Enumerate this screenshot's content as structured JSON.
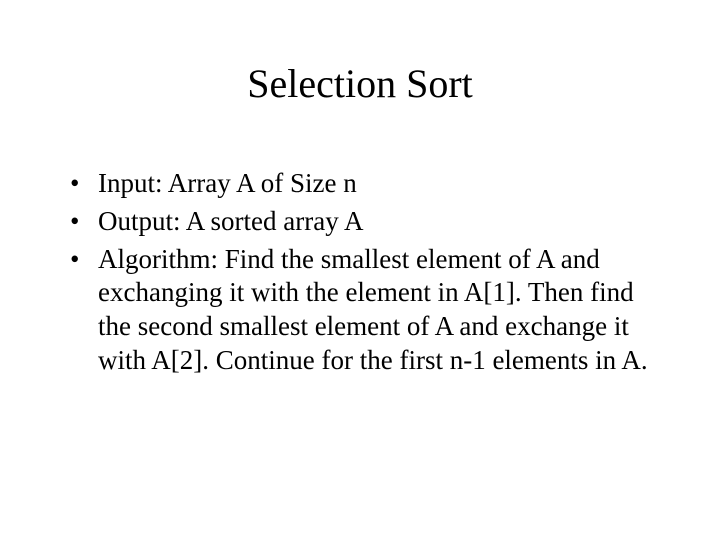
{
  "title": "Selection Sort",
  "bullets": [
    "Input: Array A of Size n",
    "Output: A sorted array A",
    "Algorithm: Find the smallest element of A and exchanging it with the element in A[1]. Then find the second smallest element of A and exchange it with A[2]. Continue for the first n-1 elements in A."
  ]
}
